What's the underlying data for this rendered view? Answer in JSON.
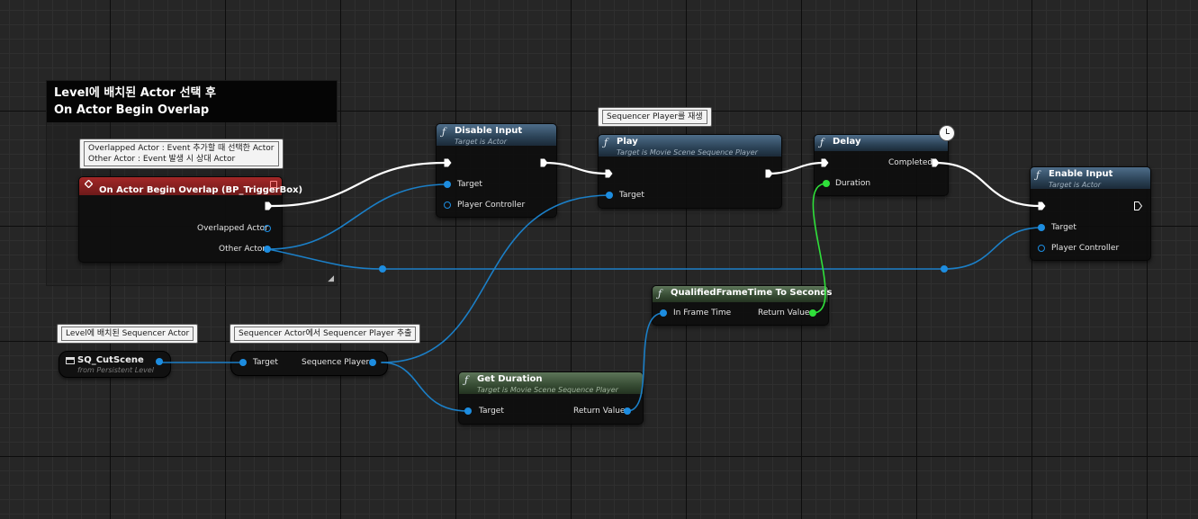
{
  "comment": {
    "line1": "Level에 배치된 Actor 선택 후",
    "line2": "On Actor Begin Overlap"
  },
  "bubbles": {
    "overlap_line1": "Overlapped Actor : Event 추가할 때 선택한 Actor",
    "overlap_line2": "Other Actor : Event 발생 시 상대 Actor",
    "play": "Sequencer Player를 재생",
    "level_actor": "Level에 배치된 Sequencer Actor",
    "extract": "Sequencer Actor에서 Sequencer Player 추출"
  },
  "nodes": {
    "event": {
      "title": "On Actor Begin Overlap (BP_TriggerBox)",
      "pin_overlapped": "Overlapped Actor",
      "pin_other": "Other Actor"
    },
    "disable_input": {
      "title": "Disable Input",
      "subtitle": "Target is Actor",
      "pin_target": "Target",
      "pin_pc": "Player Controller"
    },
    "play": {
      "title": "Play",
      "subtitle": "Target is Movie Scene Sequence Player",
      "pin_target": "Target"
    },
    "delay": {
      "title": "Delay",
      "pin_completed": "Completed",
      "pin_duration": "Duration"
    },
    "enable_input": {
      "title": "Enable Input",
      "subtitle": "Target is Actor",
      "pin_target": "Target",
      "pin_pc": "Player Controller"
    },
    "qft": {
      "title": "QualifiedFrameTime To Seconds",
      "pin_in": "In Frame Time",
      "pin_ret": "Return Value"
    },
    "get_duration": {
      "title": "Get Duration",
      "subtitle": "Target is Movie Scene Sequence Player",
      "pin_target": "Target",
      "pin_ret": "Return Value"
    },
    "sq_var": {
      "title": "SQ_CutScene",
      "subtitle": "from Persistent Level"
    },
    "get_player": {
      "pin_target": "Target",
      "pin_out": "Sequence Player"
    }
  },
  "colors": {
    "exec": "#ffffff",
    "object": "#1d8de0",
    "float": "#2fe03a",
    "event_header": "#a32727",
    "function_header": "#2b4256",
    "pure_header": "#364b33"
  },
  "icons": {
    "function": "function-icon",
    "event": "event-icon",
    "clock": "clock-icon",
    "clapper": "clapperboard-icon"
  }
}
